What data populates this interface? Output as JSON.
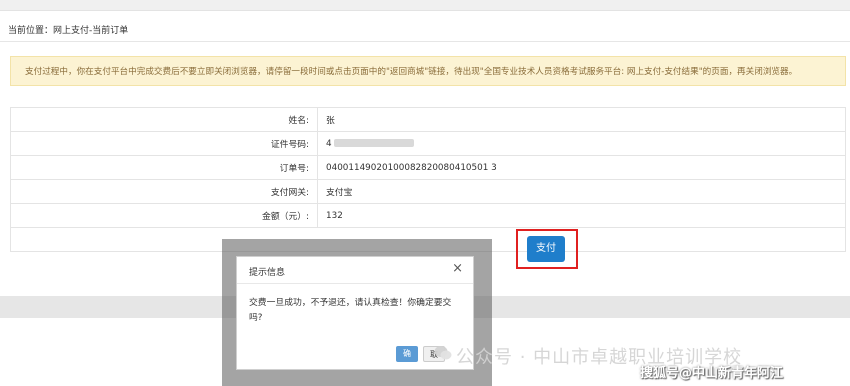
{
  "breadcrumb": "当前位置：网上支付-当前订单",
  "notice": "支付过程中，你在支付平台中完成交费后不要立即关闭浏览器，请停留一段时间或点击页面中的\"返回商城\"链接，待出现\"全国专业技术人员资格考试服务平台: 网上支付-支付结果\"的页面，再关闭浏览器。",
  "info_rows": [
    {
      "label": "姓名:",
      "value": "张"
    },
    {
      "label": "证件号码:",
      "value": "4"
    },
    {
      "label": "订单号:",
      "value": "04001149020100082820080410501 3"
    },
    {
      "label": "支付网关:",
      "value": "支付宝"
    },
    {
      "label": "金额（元）:",
      "value": "132"
    }
  ],
  "pay_button": "支付",
  "dialog": {
    "title": "提示信息",
    "close": "×",
    "message": "交费一旦成功，不予退还，请认真检查！你确定要交吗?",
    "ok": "确",
    "cancel": "取"
  },
  "watermark_main": "公众号 · 中山市卓越职业培训学校",
  "watermark_corner": "搜狐号@中山新青年阿江",
  "colors": {
    "notice_bg": "#fcf3d3",
    "pay_button": "#1f7ecb",
    "highlight_box": "#e02020"
  }
}
